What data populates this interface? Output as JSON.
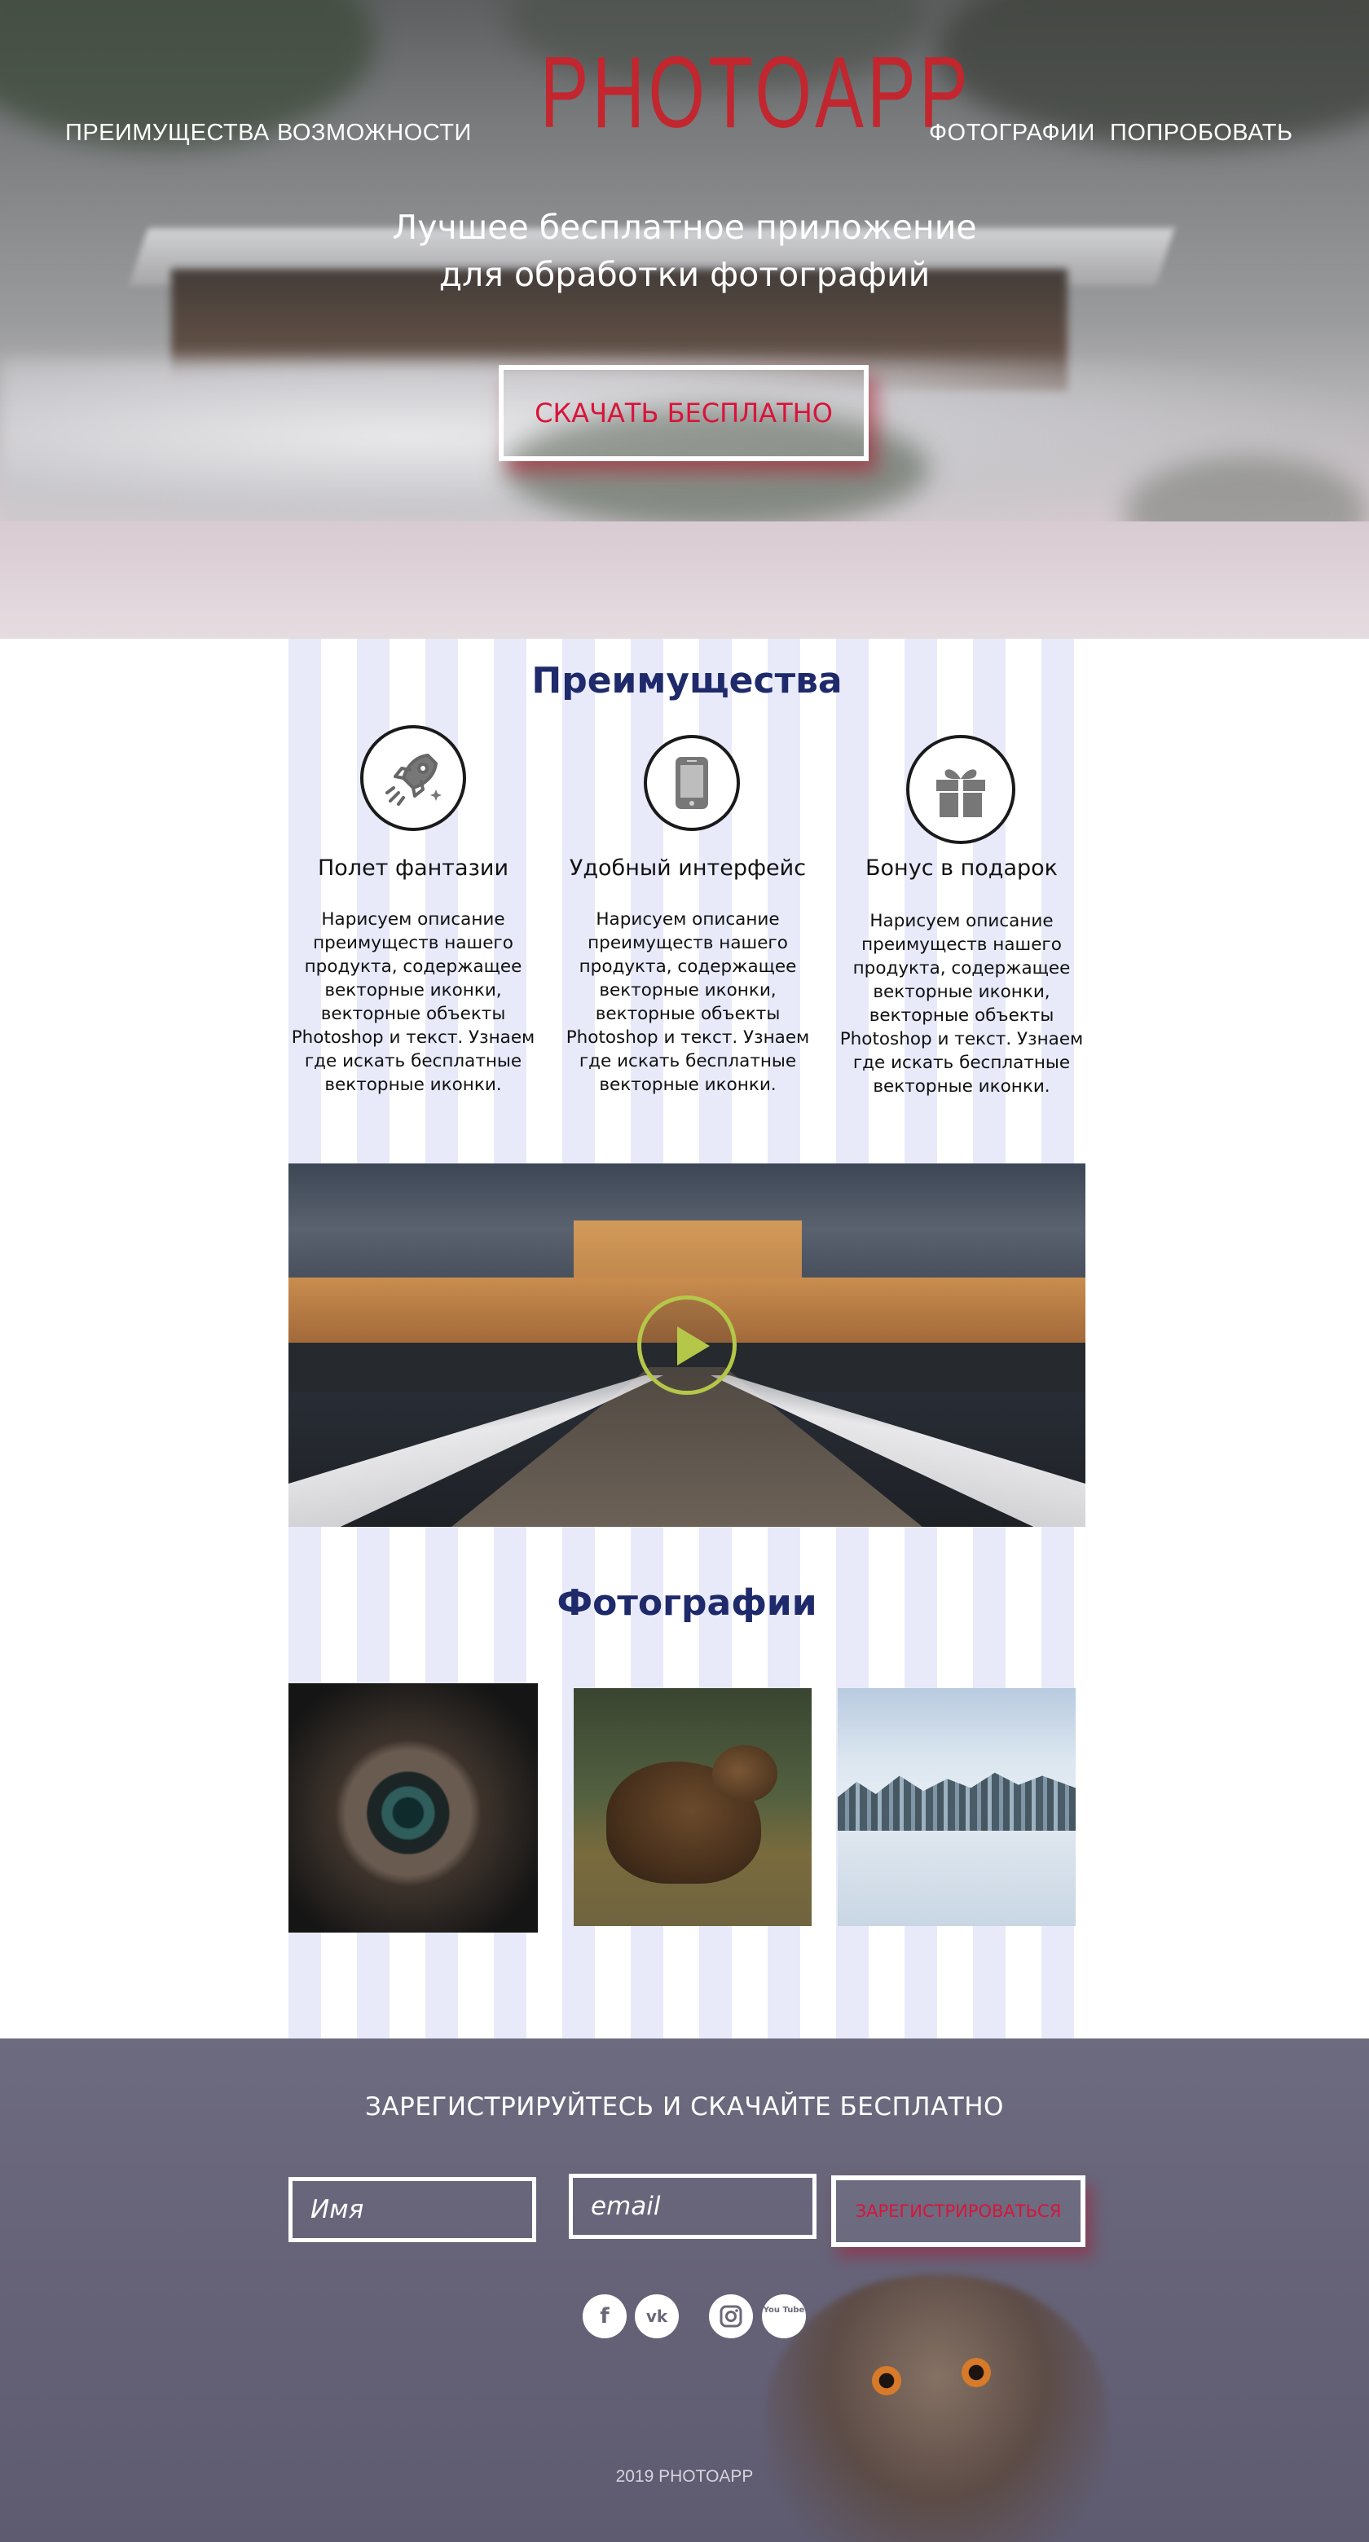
{
  "nav": {
    "left": [
      "ПРЕИМУЩЕСТВА",
      "ВОЗМОЖНОСТИ"
    ],
    "right": [
      "ФОТОГРАФИИ",
      "ПОПРОБОВАТЬ"
    ],
    "logo": "PHOTOAPP"
  },
  "hero": {
    "title_line1": "Лучшее бесплатное приложение",
    "title_line2": "для обработки фотографий",
    "cta_label": "СКАЧАТЬ БЕСПЛАТНО"
  },
  "advantages": {
    "title": "Преимущества",
    "items": [
      {
        "icon": "rocket-icon",
        "title": "Полет фантазии",
        "text": [
          "Нарисуем описание",
          "преимуществ нашего",
          "продукта, содержащее",
          "векторные иконки,",
          "векторные объекты",
          "Photoshop и текст. Узнаем",
          "где искать бесплатные",
          "векторные иконки."
        ]
      },
      {
        "icon": "smartphone-icon",
        "title": "Удобный интерфейс",
        "text": [
          "Нарисуем описание",
          "преимуществ нашего",
          "продукта, содержащее",
          "векторные иконки,",
          "векторные объекты",
          "Photoshop и текст. Узнаем",
          "где искать бесплатные",
          "векторные иконки."
        ]
      },
      {
        "icon": "gift-icon",
        "title": "Бонус в подарок",
        "text": [
          "Нарисуем описание",
          "преимуществ нашего",
          "продукта, содержащее",
          "векторные иконки,",
          "векторные объекты",
          "Photoshop и текст. Узнаем",
          "где искать бесплатные",
          "векторные иконки."
        ]
      }
    ]
  },
  "photos": {
    "title": "Фотографии"
  },
  "footer": {
    "title": "ЗАРЕГИСТРИРУЙТЕСЬ И СКАЧАЙТЕ БЕСПЛАТНО",
    "name_placeholder": "Имя",
    "email_placeholder": "email",
    "register_label": "ЗАРЕГИСТРИРОВАТЬСЯ",
    "social": [
      "f",
      "vk",
      "instagram",
      "You Tube"
    ],
    "copyright": "2019 PHOTOAPP"
  },
  "colors": {
    "accent": "#d8143a",
    "logo": "#c2262e",
    "heading": "#1f2a6b",
    "stripe": "#e8eafa",
    "play": "#b5c749"
  }
}
